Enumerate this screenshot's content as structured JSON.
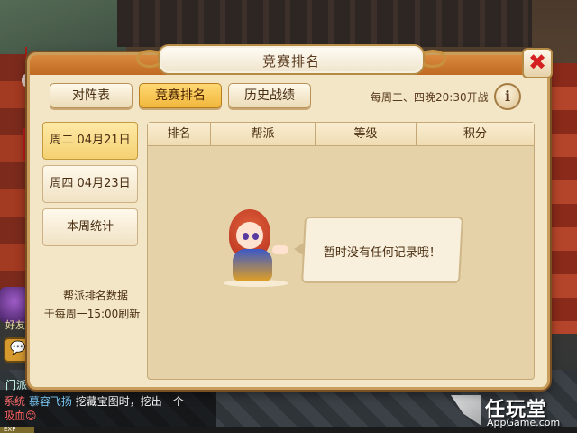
{
  "dialog": {
    "title": "竞赛排名",
    "close_label": "✖"
  },
  "tabs": [
    {
      "label": "对阵表",
      "active": false
    },
    {
      "label": "竞赛排名",
      "active": true
    },
    {
      "label": "历史战绩",
      "active": false
    }
  ],
  "schedule_text": "每周二、四晚20:30开战",
  "info_label": "i",
  "left_menu": {
    "items": [
      {
        "label": "周二  04月21日",
        "active": true
      },
      {
        "label": "周四  04月23日",
        "active": false
      },
      {
        "label": "本周统计",
        "active": false
      }
    ],
    "note_line1": "帮派排名数据",
    "note_line2": "于每周一15:00刷新"
  },
  "table": {
    "columns": [
      "排名",
      "帮派",
      "等级",
      "积分"
    ],
    "empty_message": "暂时没有任何记录哦！"
  },
  "background": {
    "side_label": "好友",
    "chat_left": "门派",
    "chat_line1_tag": "系统",
    "chat_line1_name": "慕容飞扬",
    "chat_line1_text": "挖藏宝图时，挖出一个",
    "chat_line2": "吸血😊",
    "exp_label": "EXP"
  },
  "watermark": {
    "cn": "任玩堂",
    "en": "AppGame.com"
  },
  "colors": {
    "accent_orange": "#c06a22",
    "active_tab": "#f1b73c",
    "panel_bg": "#e5d2a8",
    "close_red": "#d42020"
  }
}
